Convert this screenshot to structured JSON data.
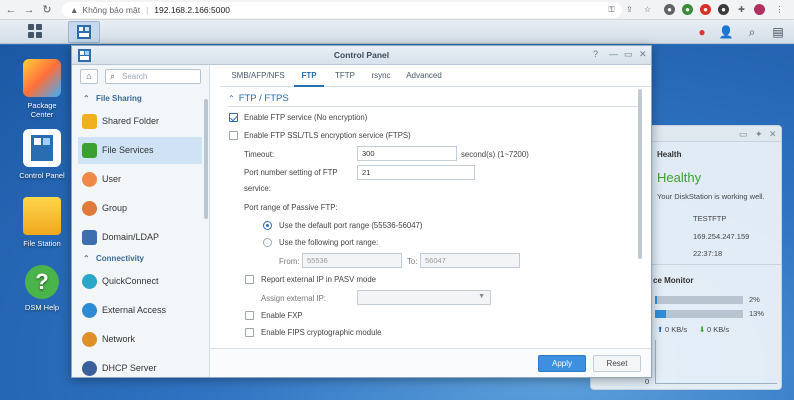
{
  "browser": {
    "security_label": "Không bảo mật",
    "url": "192.168.2.166:5000"
  },
  "desktop": {
    "icons": [
      {
        "label": "Package\nCenter",
        "line1": "Package",
        "line2": "Center"
      },
      {
        "label": "Control Panel"
      },
      {
        "label": "File Station"
      },
      {
        "label": "DSM Help"
      }
    ]
  },
  "window": {
    "title": "Control Panel",
    "search_placeholder": "Search",
    "nav": {
      "sections": [
        {
          "label": "File Sharing"
        },
        {
          "label": "Connectivity"
        }
      ],
      "items": [
        {
          "label": "Shared Folder"
        },
        {
          "label": "File Services"
        },
        {
          "label": "User"
        },
        {
          "label": "Group"
        },
        {
          "label": "Domain/LDAP"
        },
        {
          "label": "QuickConnect"
        },
        {
          "label": "External Access"
        },
        {
          "label": "Network"
        },
        {
          "label": "DHCP Server"
        }
      ]
    },
    "tabs": [
      "SMB/AFP/NFS",
      "FTP",
      "TFTP",
      "rsync",
      "Advanced"
    ],
    "section_title": "FTP / FTPS",
    "form": {
      "enable_ftp": "Enable FTP service (No encryption)",
      "enable_ftps": "Enable FTP SSL/TLS encryption service (FTPS)",
      "timeout_label": "Timeout:",
      "timeout_value": "300",
      "timeout_unit": "second(s) (1~7200)",
      "port_label_1": "Port number setting of FTP",
      "port_label_2": "service:",
      "port_value": "21",
      "passive_label": "Port range of Passive FTP:",
      "default_range": "Use the default port range (55536-56047)",
      "custom_range": "Use the following port range:",
      "from_label": "From:",
      "from_value": "55536",
      "to_label": "To:",
      "to_value": "56047",
      "report_ip": "Report external IP in PASV mode",
      "assign_ip_label": "Assign external IP:",
      "enable_fxp": "Enable FXP",
      "enable_fips": "Enable FIPS cryptographic module"
    },
    "buttons": {
      "apply": "Apply",
      "reset": "Reset"
    }
  },
  "widget": {
    "health_title": "Health",
    "health_status": "Healthy",
    "health_desc": "Your DiskStation is working well.",
    "server_name": "TESTFTP",
    "ip": "169.254.247.159",
    "time": "22:37:18",
    "monitor_title": "ce Monitor",
    "cpu_percent_label": "2%",
    "cpu_fraction": 0.02,
    "ram_percent_label": "13%",
    "ram_fraction": 0.13,
    "upload": "0 KB/s",
    "download": "0 KB/s",
    "chart_zero": "0"
  },
  "colors": {
    "accent": "#2a6db0",
    "healthy": "#3aa02f"
  }
}
